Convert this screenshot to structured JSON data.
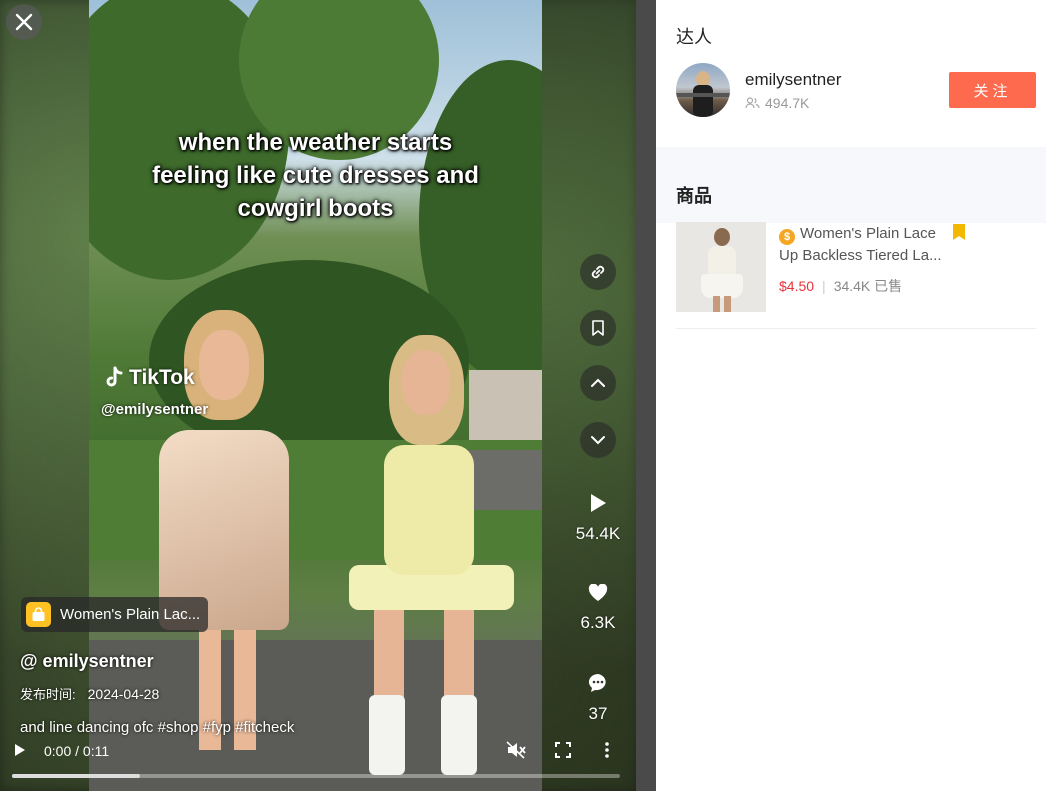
{
  "video": {
    "caption_lines": [
      "when the weather starts",
      "feeling like cute dresses and",
      "cowgirl boots"
    ],
    "watermark_brand": "TikTok",
    "watermark_handle": "@emilysentner",
    "product_pill": "Women's Plain Lac...",
    "author": "@ emilysentner",
    "publish_label": "发布时间:",
    "publish_date": "2024-04-28",
    "description": "and line dancing ofc #shop #fyp #fitcheck",
    "time": "0:00 / 0:11",
    "progress": 0.21,
    "stats": {
      "plays": "54.4K",
      "likes": "6.3K",
      "comments": "37"
    }
  },
  "panel": {
    "creator_section": "达人",
    "creator": {
      "name": "emilysentner",
      "followers": "494.7K",
      "follow_label": "关注"
    },
    "products_section": "商品",
    "product": {
      "title": "Women's Plain Lace Up Backless Tiered La...",
      "price": "$4.50",
      "sold": "34.4K 已售"
    }
  },
  "colors": {
    "follow": "#fe6a4e",
    "price": "#e8333a",
    "badge": "#ffc222",
    "bookmark": "#f5b800"
  },
  "icons": [
    "close-icon",
    "link-icon",
    "bookmark-icon",
    "chevron-up-icon",
    "chevron-down-icon",
    "play-icon",
    "heart-icon",
    "comment-icon",
    "shopping-bag-icon",
    "mute-icon",
    "fullscreen-icon",
    "more-icon",
    "followers-icon"
  ]
}
